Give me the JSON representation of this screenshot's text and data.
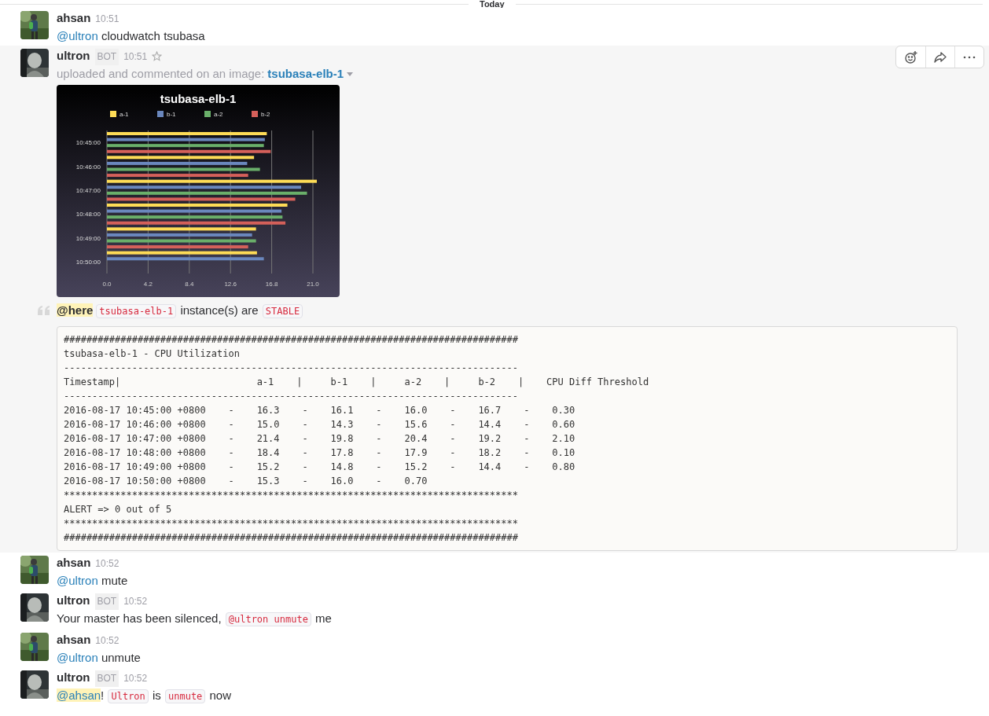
{
  "date_divider": "Today",
  "messages": [
    {
      "author": "ahsan",
      "time": "10:51",
      "parts": [
        {
          "kind": "mention",
          "text": "@ultron"
        },
        {
          "kind": "text",
          "text": " cloudwatch tsubasa"
        }
      ]
    },
    {
      "author": "ultron",
      "bot_label": "BOT",
      "time": "10:51",
      "starred": false,
      "hovered": true,
      "actions": [
        {
          "kind": "reaction"
        },
        {
          "kind": "share"
        },
        {
          "kind": "more"
        }
      ],
      "upload": {
        "prefix": "uploaded and commented on an image:",
        "title": "tsubasa-elb-1"
      },
      "chart_data": {
        "type": "bar",
        "orientation": "horizontal",
        "title": "tsubasa-elb-1",
        "categories": [
          "10:45:00",
          "10:46:00",
          "10:47:00",
          "10:48:00",
          "10:49:00",
          "10:50:00"
        ],
        "xlim": [
          0,
          21.4
        ],
        "grid": true,
        "legend": true,
        "xticks": [
          {
            "value": 0,
            "label": "0.0"
          },
          {
            "value": 4.2,
            "label": "4.2"
          },
          {
            "value": 8.4,
            "label": "8.4"
          },
          {
            "value": 12.6,
            "label": "12.6"
          },
          {
            "value": 16.8,
            "label": "16.8"
          },
          {
            "value": 21,
            "label": "21.0"
          }
        ],
        "series": [
          {
            "name": "a-1",
            "color": "#fedc56",
            "values": [
              16.3,
              15.0,
              21.4,
              18.4,
              15.2,
              15.3
            ]
          },
          {
            "name": "b-1",
            "color": "#6a87bd",
            "values": [
              16.1,
              14.3,
              19.8,
              17.8,
              14.8,
              16.0
            ]
          },
          {
            "name": "a-2",
            "color": "#6aaf6a",
            "values": [
              16.0,
              15.6,
              20.4,
              17.9,
              15.2,
              null
            ]
          },
          {
            "name": "b-2",
            "color": "#d5605a",
            "values": [
              16.7,
              14.4,
              19.2,
              18.2,
              14.4,
              null
            ]
          }
        ]
      },
      "attachment": {
        "parts": [
          {
            "kind": "here",
            "text": "@here"
          },
          {
            "kind": "code",
            "text": "tsubasa-elb-1"
          },
          {
            "kind": "text",
            "text": " instance(s) are "
          },
          {
            "kind": "code",
            "text": "STABLE"
          }
        ],
        "code_lines": [
          "################################################################################",
          "tsubasa-elb-1 - CPU Utilization",
          "--------------------------------------------------------------------------------",
          "Timestamp|                        a-1    |     b-1    |     a-2    |     b-2    |    CPU Diff Threshold",
          "--------------------------------------------------------------------------------",
          "2016-08-17 10:45:00 +0800    -    16.3    -    16.1    -    16.0    -    16.7    -    0.30",
          "2016-08-17 10:46:00 +0800    -    15.0    -    14.3    -    15.6    -    14.4    -    0.60",
          "2016-08-17 10:47:00 +0800    -    21.4    -    19.8    -    20.4    -    19.2    -    2.10",
          "2016-08-17 10:48:00 +0800    -    18.4    -    17.8    -    17.9    -    18.2    -    0.10",
          "2016-08-17 10:49:00 +0800    -    15.2    -    14.8    -    15.2    -    14.4    -    0.80",
          "2016-08-17 10:50:00 +0800    -    15.3    -    16.0    -    0.70",
          "********************************************************************************",
          "ALERT => 0 out of 5",
          "********************************************************************************",
          "################################################################################"
        ]
      }
    },
    {
      "author": "ahsan",
      "time": "10:52",
      "parts": [
        {
          "kind": "mention",
          "text": "@ultron"
        },
        {
          "kind": "text",
          "text": " mute"
        }
      ]
    },
    {
      "author": "ultron",
      "bot_label": "BOT",
      "time": "10:52",
      "parts": [
        {
          "kind": "text",
          "text": "Your master has been silenced, "
        },
        {
          "kind": "code",
          "text": "@ultron unmute"
        },
        {
          "kind": "text",
          "text": " me"
        }
      ]
    },
    {
      "author": "ahsan",
      "time": "10:52",
      "parts": [
        {
          "kind": "mention",
          "text": "@ultron"
        },
        {
          "kind": "text",
          "text": " unmute"
        }
      ]
    },
    {
      "author": "ultron",
      "bot_label": "BOT",
      "time": "10:52",
      "parts": [
        {
          "kind": "mention_self",
          "text": "@ahsan"
        },
        {
          "kind": "text",
          "text": "! "
        },
        {
          "kind": "code",
          "text": "Ultron"
        },
        {
          "kind": "text",
          "text": " is "
        },
        {
          "kind": "code",
          "text": "unmute"
        },
        {
          "kind": "text",
          "text": " now"
        }
      ]
    }
  ]
}
